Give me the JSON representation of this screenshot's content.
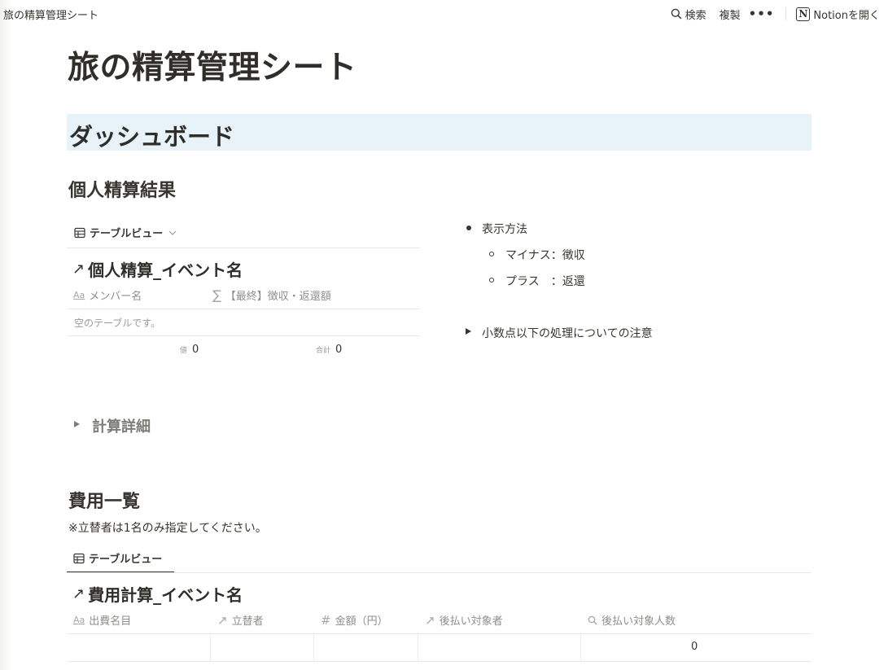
{
  "topbar": {
    "breadcrumb": "旅の精算管理シート",
    "search_label": "検索",
    "duplicate_label": "複製",
    "more_label": "•••",
    "open_in_notion_label": "Notionを開く"
  },
  "page": {
    "title": "旅の精算管理シート",
    "dashboard_heading": "ダッシュボード"
  },
  "personal": {
    "heading": "個人精算結果",
    "view_tab": "テーブルビュー",
    "db_title": "個人精算_イベント名",
    "columns": [
      {
        "icon": "Aa",
        "label": "メンバー名"
      },
      {
        "icon": "∑",
        "label": "【最終】徴収・返還額"
      }
    ],
    "empty_text": "空のテーブルです。",
    "calc": [
      {
        "label": "値",
        "value": "0"
      },
      {
        "label": "合計",
        "value": "0"
      }
    ]
  },
  "display_method": {
    "bullet": "表示方法",
    "sub_items": [
      "マイナス：徴収",
      "プラス　：返還"
    ],
    "toggle": "小数点以下の処理についての注意"
  },
  "calc_detail": {
    "toggle_heading": "計算詳細"
  },
  "expenses": {
    "heading": "費用一覧",
    "note": "※立替者は1名のみ指定してください。",
    "view_tab": "テーブルビュー",
    "db_title": "費用計算_イベント名",
    "columns": [
      {
        "icon": "Aa",
        "label": "出費名目"
      },
      {
        "icon": "↗",
        "label": "立替者"
      },
      {
        "icon": "#",
        "label": "金額（円）"
      },
      {
        "icon": "↗",
        "label": "後払い対象者"
      },
      {
        "icon": "🔍",
        "label": "後払い対象人数"
      }
    ],
    "row": {
      "count_value": "0"
    }
  },
  "colors": {
    "text": "#37352f",
    "muted": "#9b9a97",
    "dashboard_bg": "#e7f3f8",
    "divider": "#e9e9e7"
  }
}
